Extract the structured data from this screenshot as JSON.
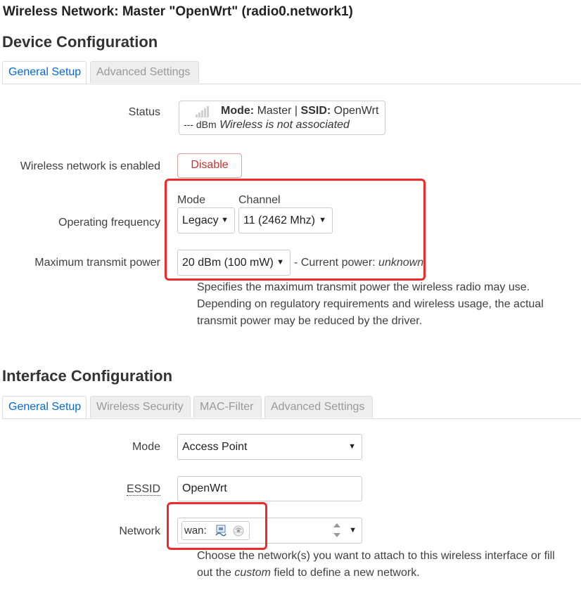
{
  "page": {
    "title": "Wireless Network: Master \"OpenWrt\" (radio0.network1)"
  },
  "device_config": {
    "heading": "Device Configuration",
    "tabs": [
      "General Setup",
      "Advanced Settings"
    ],
    "status": {
      "label": "Status",
      "mode_key": "Mode:",
      "mode_value": "Master",
      "separator": "|",
      "ssid_key": "SSID:",
      "ssid_value": "OpenWrt",
      "signal": "--- dBm",
      "association": "Wireless is not associated"
    },
    "enabled": {
      "label": "Wireless network is enabled",
      "button": "Disable"
    },
    "frequency": {
      "label": "Operating frequency",
      "mode_label": "Mode",
      "mode_value": "Legacy",
      "channel_label": "Channel",
      "channel_value": "11 (2462 Mhz)"
    },
    "txpower": {
      "label": "Maximum transmit power",
      "value": "20 dBm (100 mW)",
      "current_prefix": "- Current power:",
      "current_value": "unknown",
      "help": "Specifies the maximum transmit power the wireless radio may use. Depending on regulatory requirements and wireless usage, the actual transmit power may be reduced by the driver."
    }
  },
  "interface_config": {
    "heading": "Interface Configuration",
    "tabs": [
      "General Setup",
      "Wireless Security",
      "MAC-Filter",
      "Advanced Settings"
    ],
    "mode": {
      "label": "Mode",
      "value": "Access Point"
    },
    "essid": {
      "label": "ESSID",
      "value": "OpenWrt"
    },
    "network": {
      "label": "Network",
      "chip_label": "wan:",
      "help_before": "Choose the network(s) you want to attach to this wireless interface or fill out the ",
      "help_em": "custom",
      "help_after": " field to define a new network."
    }
  },
  "icons": {
    "signal": "signal-bars-icon",
    "ethernet": "ethernet-port-icon",
    "wifi": "wifi-disabled-icon"
  },
  "colors": {
    "accent": "#0069d6",
    "danger": "#c9302c",
    "highlight": "#ee2a2a"
  }
}
